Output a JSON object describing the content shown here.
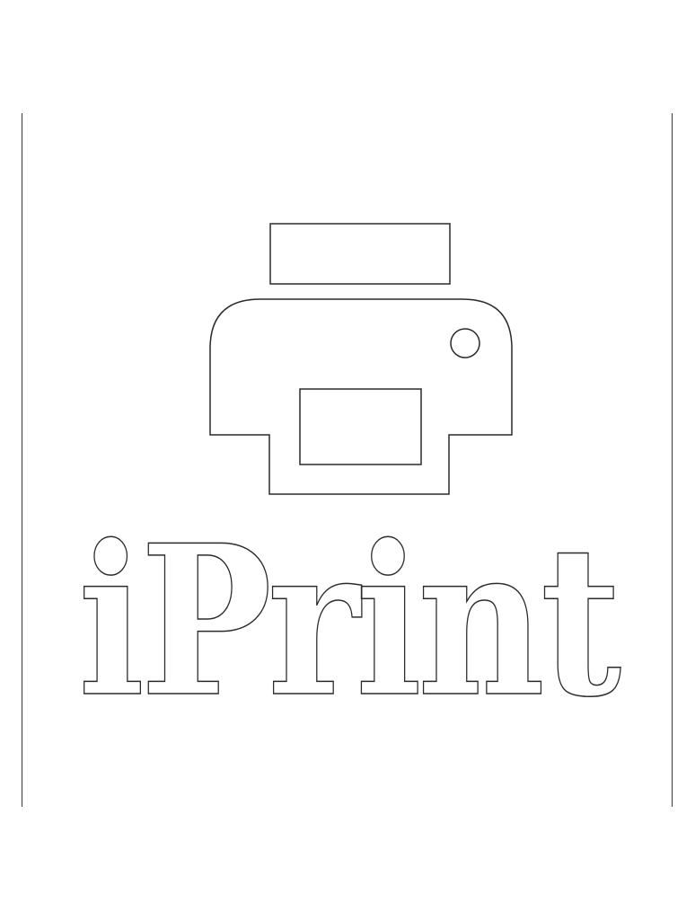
{
  "logo": {
    "icon": "printer-icon",
    "wordmark": "iPrint",
    "colors": {
      "fill": "#ffffff",
      "outline": "#2a2a2a",
      "background": "#ffffff",
      "frame": "#3a3a3a"
    }
  }
}
